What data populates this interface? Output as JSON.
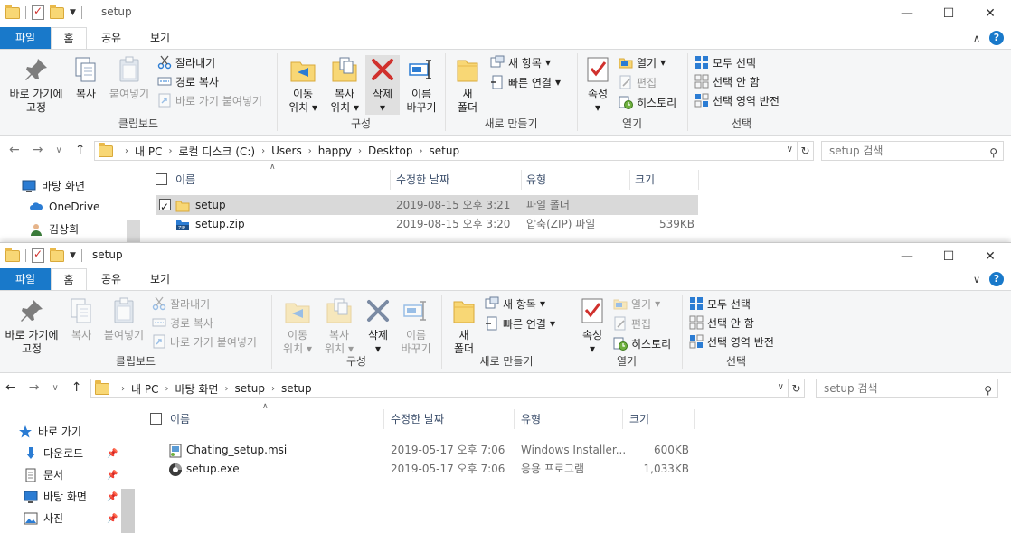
{
  "common": {
    "tabs": [
      "파일",
      "홈",
      "공유",
      "보기"
    ],
    "clipboard": {
      "pin_label_1": "바로 가기에",
      "pin_label_2": "고정",
      "copy": "복사",
      "paste": "붙여넣기",
      "cut": "잘라내기",
      "copy_path": "경로 복사",
      "paste_shortcut": "바로 가기 붙여넣기",
      "group": "클립보드"
    },
    "organize": {
      "move_1": "이동",
      "move_2": "위치",
      "copyto_1": "복사",
      "copyto_2": "위치",
      "delete": "삭제",
      "rename_1": "이름",
      "rename_2": "바꾸기",
      "group": "구성"
    },
    "new": {
      "new_folder_1": "새",
      "new_folder_2": "폴더",
      "new_item": "새 항목",
      "easy_access": "빠른 연결",
      "group": "새로 만들기"
    },
    "open": {
      "properties": "속성",
      "open": "열기",
      "edit": "편집",
      "history": "히스토리",
      "group": "열기"
    },
    "select": {
      "select_all": "모두 선택",
      "select_none": "선택 안 함",
      "invert": "선택 영역 반전",
      "group": "선택"
    },
    "columns": {
      "name": "이름",
      "date": "수정한 날짜",
      "type": "유형",
      "size": "크기"
    },
    "colors": {
      "file_tab": "#1979ca",
      "selection": "#d9d9d9",
      "delete_red": "#d0312d"
    }
  },
  "window1": {
    "title": "setup",
    "breadcrumb": [
      "내 PC",
      "로컬 디스크 (C:)",
      "Users",
      "happy",
      "Desktop",
      "setup"
    ],
    "search_placeholder": "setup 검색",
    "nav_items": [
      {
        "label": "바탕 화면",
        "icon": "desktop-icon"
      },
      {
        "label": "OneDrive",
        "icon": "cloud-icon"
      },
      {
        "label": "김상희",
        "icon": "user-icon"
      }
    ],
    "files": [
      {
        "name": "setup",
        "date": "2019-08-15 오후 3:21",
        "type": "파일 폴더",
        "size": "",
        "icon": "folder-icon",
        "selected": true
      },
      {
        "name": "setup.zip",
        "date": "2019-08-15 오후 3:20",
        "type": "압축(ZIP) 파일",
        "size": "539KB",
        "icon": "zip-icon",
        "selected": false
      }
    ]
  },
  "window2": {
    "title": "setup",
    "breadcrumb": [
      "내 PC",
      "바탕 화면",
      "setup",
      "setup"
    ],
    "search_placeholder": "setup 검색",
    "nav_items": [
      {
        "label": "바로 가기",
        "icon": "star-icon",
        "pinned": false
      },
      {
        "label": "다운로드",
        "icon": "download-icon",
        "pinned": true
      },
      {
        "label": "문서",
        "icon": "document-icon",
        "pinned": true
      },
      {
        "label": "바탕 화면",
        "icon": "desktop-icon",
        "pinned": true
      },
      {
        "label": "사진",
        "icon": "pictures-icon",
        "pinned": true
      }
    ],
    "files": [
      {
        "name": "Chating_setup.msi",
        "date": "2019-05-17 오후 7:06",
        "type": "Windows Installer...",
        "size": "600KB",
        "icon": "installer-icon"
      },
      {
        "name": "setup.exe",
        "date": "2019-05-17 오후 7:06",
        "type": "응용 프로그램",
        "size": "1,033KB",
        "icon": "exe-icon"
      }
    ]
  }
}
